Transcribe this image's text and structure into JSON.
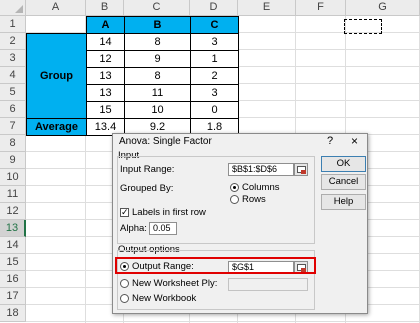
{
  "spreadsheet": {
    "columns": [
      "A",
      "B",
      "C",
      "D",
      "E",
      "F",
      "G"
    ],
    "rows": [
      "1",
      "2",
      "3",
      "4",
      "5",
      "6",
      "7",
      "8",
      "9",
      "10",
      "11",
      "12",
      "13",
      "14",
      "15",
      "16",
      "17",
      "18"
    ],
    "active_row": "13",
    "table_headers": [
      "A",
      "B",
      "C"
    ],
    "group_label": "Group",
    "average_label": "Average",
    "data": [
      [
        "14",
        "8",
        "3"
      ],
      [
        "12",
        "9",
        "1"
      ],
      [
        "13",
        "8",
        "2"
      ],
      [
        "13",
        "11",
        "3"
      ],
      [
        "15",
        "10",
        "0"
      ]
    ],
    "averages": [
      "13.4",
      "9.2",
      "1.8"
    ],
    "colors": {
      "header_fill": "#00b0f0",
      "active_row_accent": "#217346"
    }
  },
  "dialog": {
    "title": "Anova: Single Factor",
    "help_glyph": "?",
    "close_glyph": "×",
    "input_section": "Input",
    "input_range_label_pre": "Input Range:",
    "input_range_value": "$B$1:$D$6",
    "grouped_by_label": "Grouped By:",
    "columns_label": "Columns",
    "rows_label": "Rows",
    "labels_first_row": "Labels in first row",
    "alpha_label": "Alpha:",
    "alpha_value": "0.05",
    "output_section": "Output options",
    "output_range_label": "Output Range:",
    "output_range_value": "$G$1",
    "new_ws_label": "New Worksheet Ply:",
    "new_ws_value": "",
    "new_wb_label": "New Workbook",
    "buttons": {
      "ok": "OK",
      "cancel": "Cancel",
      "help": "Help"
    },
    "selected_grouping": "Columns",
    "selected_output": "Output Range",
    "labels_checked": true,
    "highlight_color": "#e00000"
  }
}
